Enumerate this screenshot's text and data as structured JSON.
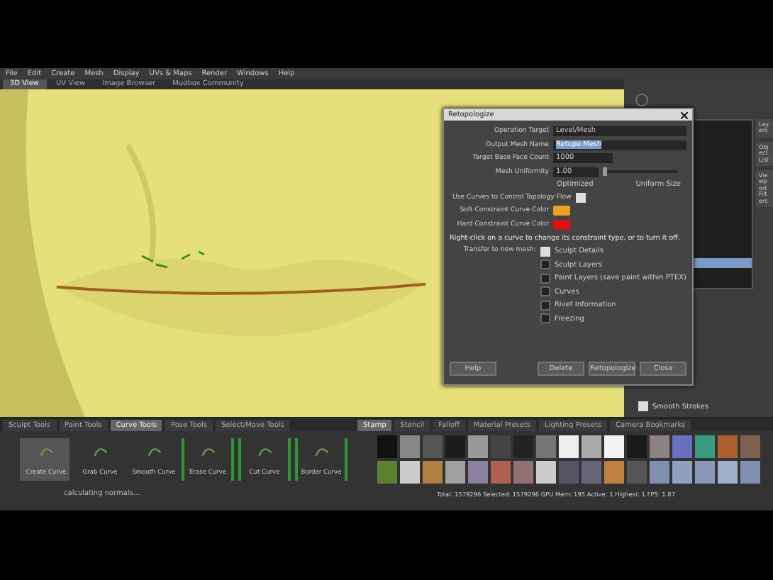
{
  "menu": [
    "File",
    "Edit",
    "Create",
    "Mesh",
    "Display",
    "UVs & Maps",
    "Render",
    "Windows",
    "Help"
  ],
  "view_tabs": [
    {
      "label": "3D View",
      "selected": true
    },
    {
      "label": "UV View",
      "selected": false
    },
    {
      "label": "Image Browser",
      "selected": false
    },
    {
      "label": "Mudbox Community",
      "selected": false
    }
  ],
  "dialog": {
    "title": "Retopologize",
    "fields": [
      {
        "label": "Operation Target",
        "value": "Level/Mesh",
        "selected": false
      },
      {
        "label": "Output Mesh Name",
        "value": "Retopo Mesh",
        "selected": true
      },
      {
        "label": "Target Base Face Count",
        "value": "1000",
        "selected": false
      }
    ],
    "uniformity": {
      "label": "Mesh Uniformity",
      "value": "1.00",
      "level": 0.0,
      "left": "Optimized",
      "right": "Uniform Size"
    },
    "use_curves": {
      "label": "Use Curves to Control Topology Flow",
      "checked": true
    },
    "curve_colors": [
      {
        "label": "Soft Constraint Curve Color",
        "color": "#f0a020"
      },
      {
        "label": "Hard Constraint Curve Color",
        "color": "#e01010"
      }
    ],
    "hint": "Right-click on a curve to change its constraint type, or to turn it off.",
    "transfer_label": "Transfer to new mesh:",
    "transfer": [
      {
        "label": "Sculpt Details",
        "checked": true
      },
      {
        "label": "Sculpt Layers",
        "checked": false
      },
      {
        "label": "Paint Layers (save paint within PTEX)",
        "checked": false
      },
      {
        "label": "Curves",
        "checked": false
      },
      {
        "label": "Rivet Information",
        "checked": false
      },
      {
        "label": "Freezing",
        "checked": false
      }
    ],
    "buttons": [
      "Help",
      "Delete",
      "Retopologize",
      "Close"
    ]
  },
  "side_tabs": [
    "Layers",
    "Object List",
    "Viewport Filters"
  ],
  "smooth_strokes": {
    "label": "Smooth Strokes",
    "checked": true
  },
  "tool_tabs": [
    {
      "label": "Sculpt Tools",
      "selected": false
    },
    {
      "label": "Paint Tools",
      "selected": false
    },
    {
      "label": "Curve Tools",
      "selected": true
    },
    {
      "label": "Pose Tools",
      "selected": false
    },
    {
      "label": "Select/Move Tools",
      "selected": false
    }
  ],
  "tools": [
    {
      "label": "Create Curve",
      "selected": true
    },
    {
      "label": "Grab Curve",
      "selected": false
    },
    {
      "label": "Smooth Curve",
      "selected": false
    },
    {
      "label": "Erase Curve",
      "selected": false
    },
    {
      "label": "Cut Curve",
      "selected": false
    },
    {
      "label": "Border Curve",
      "selected": false
    }
  ],
  "tool_status": "calculating normals...",
  "stamp_tabs": [
    {
      "label": "Stamp",
      "selected": true
    },
    {
      "label": "Stencil",
      "selected": false
    },
    {
      "label": "Falloff",
      "selected": false
    },
    {
      "label": "Material Presets",
      "selected": false
    },
    {
      "label": "Lighting Presets",
      "selected": false
    },
    {
      "label": "Camera Bookmarks",
      "selected": false
    }
  ],
  "status_bar": "Total: 1579296  Selected: 1579296  GPU Mem: 195  Active: 1  Highest: 1  FPS: 1.87"
}
